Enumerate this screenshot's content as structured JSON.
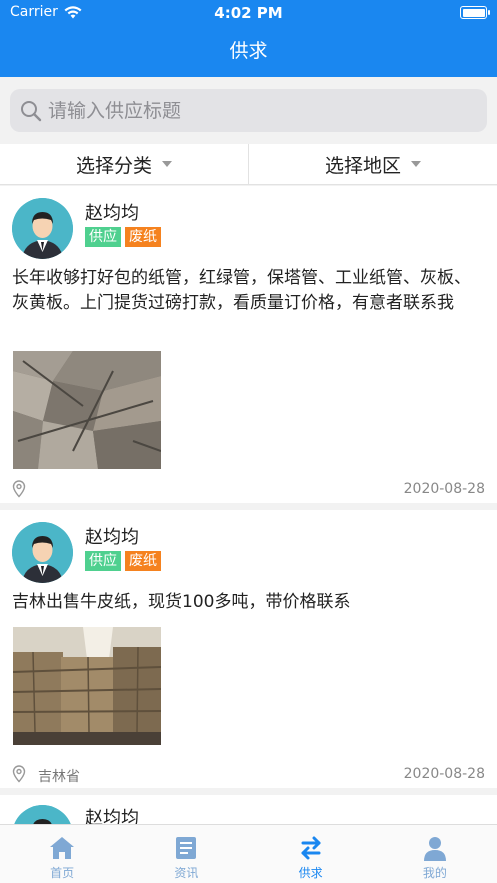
{
  "status_bar": {
    "carrier": "Carrier",
    "time": "4:02 PM"
  },
  "nav": {
    "title": "供求"
  },
  "search": {
    "placeholder": "请输入供应标题"
  },
  "filters": {
    "category_label": "选择分类",
    "region_label": "选择地区"
  },
  "posts": [
    {
      "user": "赵均均",
      "tags": [
        "供应",
        "废纸"
      ],
      "text": "长年收够打好包的纸管，红绿管，保塔管、工业纸管、灰板、灰黄板。上门提货过磅打款，看质量订价格，有意者联系我",
      "location": "",
      "date": "2020-08-28"
    },
    {
      "user": "赵均均",
      "tags": [
        "供应",
        "废纸"
      ],
      "text": "吉林出售牛皮纸，现货100多吨，带价格联系",
      "location": "吉林省",
      "date": "2020-08-28"
    },
    {
      "user": "赵均均"
    }
  ],
  "tabbar": {
    "items": [
      {
        "label": "首页",
        "icon": "home-icon"
      },
      {
        "label": "资讯",
        "icon": "news-icon"
      },
      {
        "label": "供求",
        "icon": "exchange-icon"
      },
      {
        "label": "我的",
        "icon": "profile-icon"
      }
    ],
    "active_index": 2,
    "active_color": "#1a87f0",
    "inactive_color": "#7fa8d4"
  },
  "colors": {
    "brand": "#1a87f0",
    "tag_supply": "#4fd08f",
    "tag_category": "#f5821f"
  }
}
